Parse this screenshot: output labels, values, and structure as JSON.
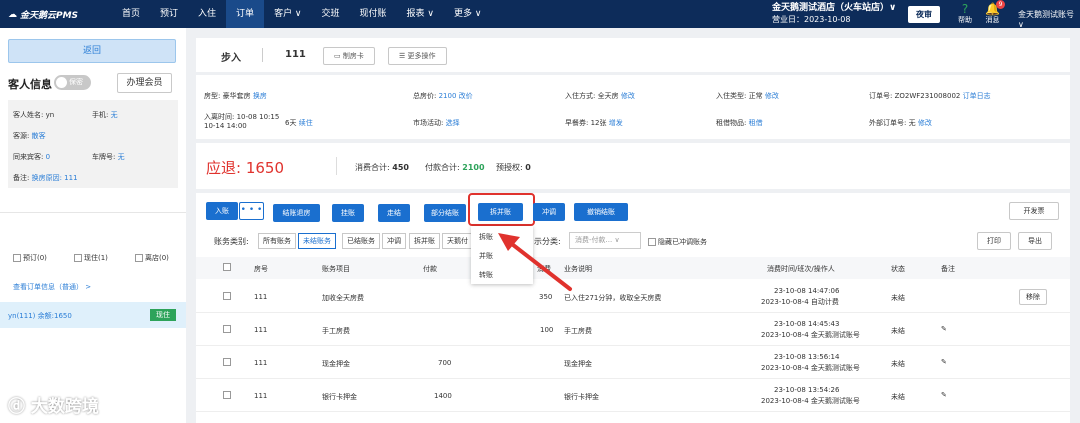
{
  "app": {
    "logo": "金天鹅云PMS"
  },
  "nav": [
    "首页",
    "预订",
    "入住",
    "订单",
    "客户 ∨",
    "交班",
    "现付账",
    "报表 ∨",
    "更多 ∨"
  ],
  "hotel": {
    "name": "金天鹅测试酒店（火车站店）∨",
    "date": "营业日：2023-10-08",
    "night": "夜审",
    "help": "帮助",
    "msg": "消息",
    "badge": "9",
    "account": "金天鹅测试账号 ∨"
  },
  "left": {
    "back": "返回",
    "guest_title": "客人信息",
    "toggle": "保密",
    "member": "办理会员",
    "name_l": "客人姓名:",
    "name_v": "yn",
    "phone_l": "手机:",
    "phone_v": "无",
    "src_l": "客源:",
    "src_v": "散客",
    "companion_l": "同来宾客:",
    "companion_v": "0",
    "car_l": "车牌号:",
    "car_v": "无",
    "note_l": "备注:",
    "note_v": "换房原因: 111",
    "cb1": "预订(0)",
    "cb2": "现住(1)",
    "cb3": "离店(0)",
    "viewall": "查看订单信息（普通） >",
    "room": "yn(111)  余额:1650",
    "room_status": "现住"
  },
  "header": {
    "status": "步入",
    "room": "111",
    "card": "制房卡",
    "more": "更多操作"
  },
  "info": {
    "roomtype_l": "房型: 豪华套房",
    "roomtype_v": "换房",
    "total_l": "总房价: ",
    "total_v": "2100 改价",
    "checkin_l": "入住方式: 全天房",
    "checkin_v": "修改",
    "ctype_l": "入住类型: 正常",
    "ctype_v": "修改",
    "order_l": "订单号: ZO2WF231008002",
    "order_v": "订单日志",
    "time_l": "入离时间: 10-08 10:15\n10-14 14:00",
    "days": "6天",
    "time_v": "续住",
    "mkt_l": "市场活动:",
    "mkt_v": "选择",
    "bf_l": "早餐券: 12张",
    "bf_v": "增发",
    "rent_l": "租借物品:",
    "rent_v": "租借",
    "ext_l": "外部订单号: 无",
    "ext_v": "修改"
  },
  "summary": {
    "due": "应退: 1650",
    "consume_l": "消费合计:",
    "consume_v": "450",
    "pay_l": "付款合计:",
    "pay_v": "2100",
    "pre_l": "预授权:",
    "pre_v": "0"
  },
  "actions": {
    "checkin": "入账",
    "dots": "• • •",
    "settle_out": "结账退房",
    "hang": "挂账",
    "walk": "走结",
    "partial": "部分结账",
    "split": "拆并账",
    "reverse": "冲调",
    "cancel": "撤销结账",
    "invoice": "开发票",
    "print": "打印",
    "export": "导出"
  },
  "filters": {
    "label": "账务类别:",
    "items": [
      "所有账务",
      "未结账务",
      "已结账务",
      "冲调",
      "拆并账",
      "天鹅付"
    ],
    "cat_label": "示分类:",
    "cat_sel": "消费-付款...",
    "hide": "隐藏已冲调账务"
  },
  "dropdown": [
    "拆账",
    "并账",
    "转账"
  ],
  "table": {
    "headers": [
      "房号",
      "账务项目",
      "付款",
      "消费",
      "业务说明",
      "消费时间/班次/操作人",
      "状态",
      "备注"
    ],
    "rows": [
      {
        "room": "111",
        "item": "加收全天房费",
        "pay": "",
        "cons": "350",
        "desc": "已入住271分钟，收取全天房费",
        "t1": "23-10-08 14:47:06",
        "t2": "2023-10-08-4 自动计费",
        "status": "未结",
        "action": "移除"
      },
      {
        "room": "111",
        "item": "手工房费",
        "pay": "",
        "cons": "100",
        "desc": "手工房费",
        "t1": "23-10-08 14:45:43",
        "t2": "2023-10-08-4 金天鹅测试账号",
        "status": "未结",
        "action": "✎"
      },
      {
        "room": "111",
        "item": "现金押金",
        "pay": "700",
        "cons": "",
        "desc": "现金押金",
        "t1": "23-10-08 13:56:14",
        "t2": "2023-10-08-4 金天鹅测试账号",
        "status": "未结",
        "action": "✎"
      },
      {
        "room": "111",
        "item": "银行卡押金",
        "pay": "1400",
        "cons": "",
        "desc": "银行卡押金",
        "t1": "23-10-08 13:54:26",
        "t2": "2023-10-08-4 金天鹅测试账号",
        "status": "未结",
        "action": "✎"
      }
    ]
  },
  "watermark": "大数跨境"
}
